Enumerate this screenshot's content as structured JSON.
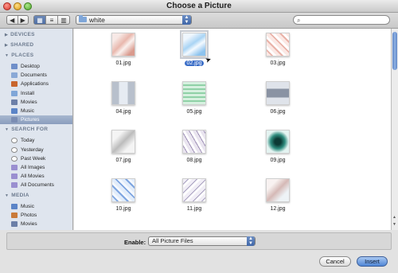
{
  "window": {
    "title": "Choose a Picture"
  },
  "toolbar": {
    "path_popup": "white",
    "search_placeholder": ""
  },
  "sidebar": {
    "sections": [
      {
        "label": "DEVICES",
        "items": []
      },
      {
        "label": "SHARED",
        "items": []
      },
      {
        "label": "PLACES",
        "items": [
          {
            "label": "Desktop",
            "icon": "desktop-icon"
          },
          {
            "label": "Documents",
            "icon": "documents-icon"
          },
          {
            "label": "Applications",
            "icon": "applications-icon"
          },
          {
            "label": "Install",
            "icon": "folder-icon"
          },
          {
            "label": "Movies",
            "icon": "movies-icon"
          },
          {
            "label": "Music",
            "icon": "music-icon"
          },
          {
            "label": "Pictures",
            "icon": "pictures-icon",
            "selected": true
          }
        ]
      },
      {
        "label": "SEARCH FOR",
        "items": [
          {
            "label": "Today",
            "icon": "clock-icon"
          },
          {
            "label": "Yesterday",
            "icon": "clock-icon"
          },
          {
            "label": "Past Week",
            "icon": "clock-icon"
          },
          {
            "label": "All Images",
            "icon": "smart-folder-icon"
          },
          {
            "label": "All Movies",
            "icon": "smart-folder-icon"
          },
          {
            "label": "All Documents",
            "icon": "smart-folder-icon"
          }
        ]
      },
      {
        "label": "MEDIA",
        "items": [
          {
            "label": "Music",
            "icon": "music-icon"
          },
          {
            "label": "Photos",
            "icon": "photos-icon"
          },
          {
            "label": "Movies",
            "icon": "movies-icon"
          }
        ]
      }
    ]
  },
  "files": [
    {
      "name": "01.jpg"
    },
    {
      "name": "02.jpg",
      "selected": true
    },
    {
      "name": "03.jpg"
    },
    {
      "name": "04.jpg"
    },
    {
      "name": "05.jpg"
    },
    {
      "name": "06.jpg"
    },
    {
      "name": "07.jpg"
    },
    {
      "name": "08.jpg"
    },
    {
      "name": "09.jpg"
    },
    {
      "name": "10.jpg"
    },
    {
      "name": "11.jpg"
    },
    {
      "name": "12.jpg"
    }
  ],
  "footer": {
    "enable_label": "Enable:",
    "enable_value": "All Picture Files",
    "cancel_label": "Cancel",
    "insert_label": "Insert"
  },
  "colors": {
    "accent": "#3a6dc7",
    "sidebar_bg": "#dfe5ee"
  }
}
